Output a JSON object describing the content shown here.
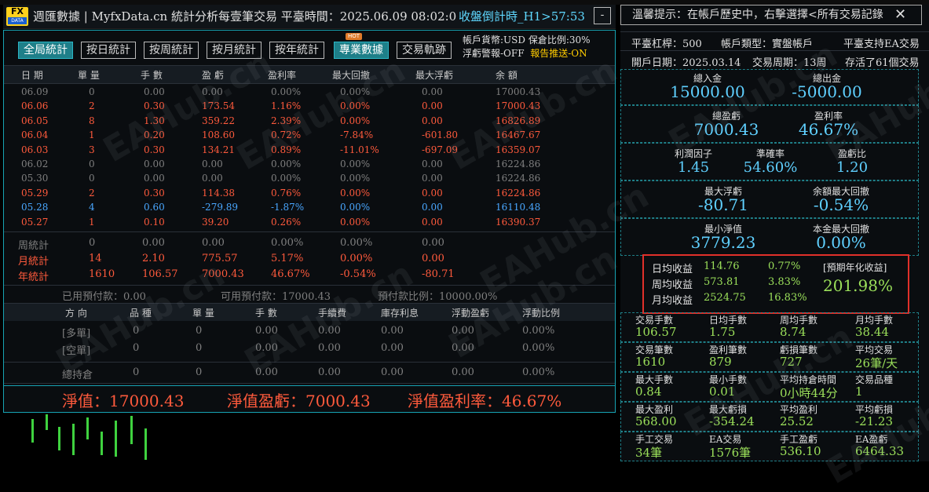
{
  "topbar_text": "(hidden chart header text)",
  "header": {
    "title": "週匯數據 | MyfxData.cn  統計分析每壹筆交易  平臺時間：2025.06.09 08:02:0",
    "countdown": "收盤倒計時_H1>57:53",
    "min_button": "-"
  },
  "tabs": [
    "全局統計",
    "按日統計",
    "按周統計",
    "按月統計",
    "按年統計",
    "專業數據",
    "交易軌跡"
  ],
  "hot_badge": "HOT",
  "account": {
    "line1": "帳戶貨幣:USD  保倉比例:30%",
    "line2a": "浮虧警報-OFF",
    "line2b": "報告推送-ON"
  },
  "table_headers": [
    "日 期",
    "單 量",
    "手 數",
    "盈 虧",
    "盈利率",
    "最大回撤",
    "最大浮虧",
    "余 額"
  ],
  "rows": [
    {
      "cells": [
        "06.09",
        "0",
        "0.00",
        "0.00",
        "0.00%",
        "0.00%",
        "0.00",
        "17000.43"
      ],
      "color": "gray"
    },
    {
      "cells": [
        "06.06",
        "2",
        "0.30",
        "173.54",
        "1.16%",
        "0.00%",
        "0.00",
        "17000.43"
      ],
      "color": "red"
    },
    {
      "cells": [
        "06.05",
        "8",
        "1.30",
        "359.22",
        "2.39%",
        "0.00%",
        "0.00",
        "16826.89"
      ],
      "color": "red"
    },
    {
      "cells": [
        "06.04",
        "1",
        "0.20",
        "108.60",
        "0.72%",
        "-7.84%",
        "-601.80",
        "16467.67"
      ],
      "color": "red"
    },
    {
      "cells": [
        "06.03",
        "3",
        "0.30",
        "134.21",
        "0.89%",
        "-11.01%",
        "-697.09",
        "16359.07"
      ],
      "color": "red"
    },
    {
      "cells": [
        "06.02",
        "0",
        "0.00",
        "0.00",
        "0.00%",
        "0.00%",
        "0.00",
        "16224.86"
      ],
      "color": "gray"
    },
    {
      "cells": [
        "05.30",
        "0",
        "0.00",
        "0.00",
        "0.00%",
        "0.00%",
        "0.00",
        "16224.86"
      ],
      "color": "gray"
    },
    {
      "cells": [
        "05.29",
        "2",
        "0.30",
        "114.38",
        "0.76%",
        "0.00%",
        "0.00",
        "16224.86"
      ],
      "color": "red"
    },
    {
      "cells": [
        "05.28",
        "4",
        "0.60",
        "-279.89",
        "-1.87%",
        "0.00%",
        "0.00",
        "16110.48"
      ],
      "color": "blue"
    },
    {
      "cells": [
        "05.27",
        "1",
        "0.10",
        "39.20",
        "0.26%",
        "0.00%",
        "0.00",
        "16390.37"
      ],
      "color": "red"
    }
  ],
  "summary_rows": [
    {
      "cells": [
        "周統計",
        "0",
        "0.00",
        "0.00",
        "0.00%",
        "0.00%",
        "0.00"
      ],
      "color": "gray"
    },
    {
      "cells": [
        "月統計",
        "14",
        "2.10",
        "775.57",
        "5.17%",
        "0.00%",
        "0.00"
      ],
      "color": "red"
    },
    {
      "cells": [
        "年統計",
        "1610",
        "106.57",
        "7000.43",
        "46.67%",
        "-0.54%",
        "-80.71"
      ],
      "color": "red"
    }
  ],
  "prepay": {
    "used": "已用預付款：0.00",
    "available": "可用預付款：17000.43",
    "ratio": "預付款比例：10000.00%"
  },
  "position_headers": [
    "方 向",
    "品 種",
    "單 量",
    "手 數",
    "手續費",
    "庫存利息",
    "浮動盈虧",
    "浮動比例"
  ],
  "positions": [
    {
      "cells": [
        "[多單]",
        "0",
        "0",
        "0.00",
        "0.00",
        "0.00",
        "0.00",
        "0.00%"
      ]
    },
    {
      "cells": [
        "[空單]",
        "0",
        "0",
        "0.00",
        "0.00",
        "0.00",
        "0.00",
        "0.00%"
      ]
    }
  ],
  "total_row": {
    "cells": [
      "總持倉",
      "0",
      "0",
      "0.00",
      "0.00",
      "0.00",
      "0.00",
      "0.00%"
    ]
  },
  "net": {
    "equity": "淨值：17000.43",
    "pl": "淨值盈虧：7000.43",
    "rate": "淨值盈利率：46.67%"
  },
  "right": {
    "warning": "溫馨提示：在帳戶歷史中，右擊選擇<所有交易記錄",
    "close": "✕",
    "info1": {
      "leverage": "平臺杠桿：500",
      "type": "帳戶類型：實盤帳戶",
      "ea": "平臺支持EA交易"
    },
    "info2": {
      "open": "開戶日期：2025.03.14",
      "period": "交易周期：13周",
      "survive": "存活了61個交易"
    },
    "deposit": {
      "label": "總入金",
      "value": "15000.00"
    },
    "withdraw": {
      "label": "總出金",
      "value": "-5000.00"
    },
    "total_pl": {
      "label": "總盈虧",
      "value": "7000.43"
    },
    "profit_rate": {
      "label": "盈利率",
      "value": "46.67%"
    },
    "profit_factor": {
      "label": "利潤因子",
      "value": "1.45"
    },
    "accuracy": {
      "label": "準確率",
      "value": "54.60%"
    },
    "pl_ratio": {
      "label": "盈虧比",
      "value": "1.20"
    },
    "max_float": {
      "label": "最大浮虧",
      "value": "-80.71"
    },
    "bal_dd": {
      "label": "余額最大回撤",
      "value": "-0.54%"
    },
    "min_equity": {
      "label": "最小淨值",
      "value": "3779.23"
    },
    "cap_dd": {
      "label": "本金最大回撤",
      "value": "0.00%"
    },
    "returns": {
      "daily_label": "日均收益",
      "daily_val": "114.76",
      "daily_pct": "0.77%",
      "weekly_label": "周均收益",
      "weekly_val": "573.81",
      "weekly_pct": "3.83%",
      "monthly_label": "月均收益",
      "monthly_val": "2524.75",
      "monthly_pct": "16.83%",
      "annual_label": "[預期年化收益]",
      "annual_val": "201.98%"
    },
    "stats": [
      [
        {
          "l": "交易手數",
          "v": "106.57"
        },
        {
          "l": "日均手數",
          "v": "1.75"
        },
        {
          "l": "周均手數",
          "v": "8.74"
        },
        {
          "l": "月均手數",
          "v": "38.44"
        }
      ],
      [
        {
          "l": "交易筆數",
          "v": "1610"
        },
        {
          "l": "盈利筆數",
          "v": "879"
        },
        {
          "l": "虧損筆數",
          "v": "727"
        },
        {
          "l": "平均交易",
          "v": "26筆/天"
        }
      ],
      [
        {
          "l": "最大手數",
          "v": "0.84"
        },
        {
          "l": "最小手數",
          "v": "0.01"
        },
        {
          "l": "平均持倉時間",
          "v": "0小時44分"
        },
        {
          "l": "交易品種",
          "v": "1"
        }
      ],
      [
        {
          "l": "最大盈利",
          "v": "568.00"
        },
        {
          "l": "最大虧損",
          "v": "-354.24"
        },
        {
          "l": "平均盈利",
          "v": "25.52"
        },
        {
          "l": "平均虧損",
          "v": "-21.23"
        }
      ],
      [
        {
          "l": "手工交易",
          "v": "34筆"
        },
        {
          "l": "EA交易",
          "v": "1576筆"
        },
        {
          "l": "手工盈虧",
          "v": "536.10"
        },
        {
          "l": "EA盈虧",
          "v": "6464.33"
        }
      ]
    ]
  },
  "watermark": "EAHub.cn"
}
